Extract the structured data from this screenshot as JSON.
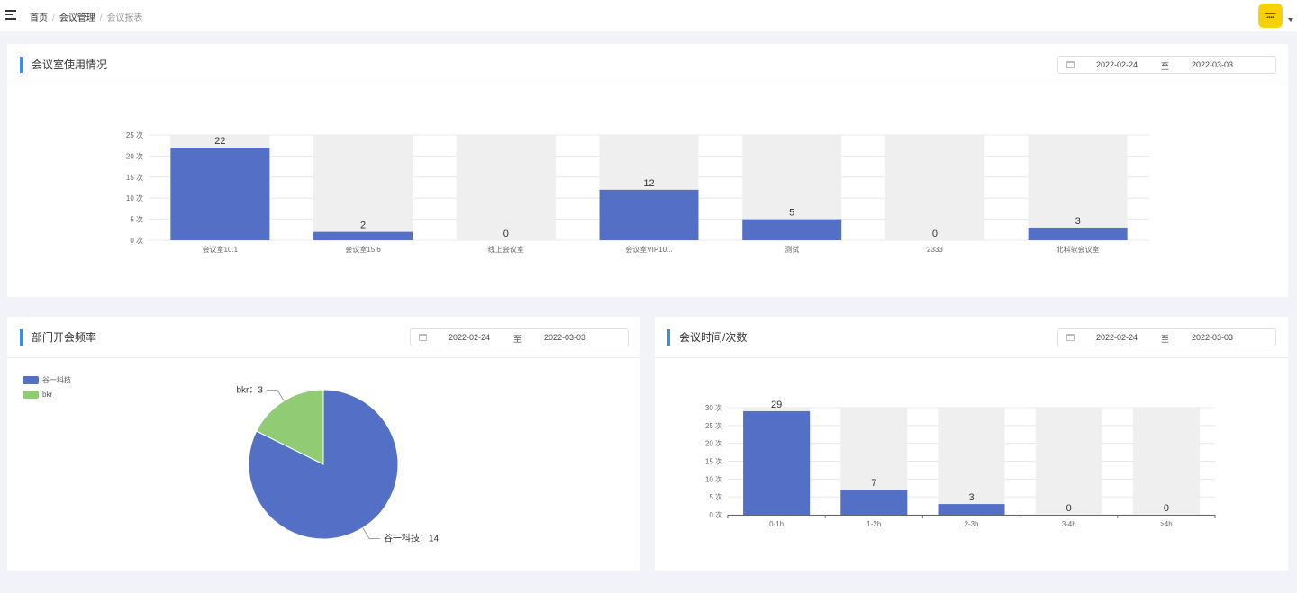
{
  "header": {
    "breadcrumb": [
      "首页",
      "会议管理",
      "会议报表"
    ],
    "separator": "/"
  },
  "colors": {
    "bar": "#5470c6",
    "bar_bg": "#efefef",
    "pie_green": "#91cc75",
    "accent": "#3a8ee6"
  },
  "range_to_label": "至",
  "room_usage": {
    "title": "会议室使用情况",
    "date_start": "2022-02-24",
    "date_end": "2022-03-03"
  },
  "dept_freq": {
    "title": "部门开会频率",
    "date_start": "2022-02-24",
    "date_end": "2022-03-03",
    "legend": [
      "谷一科技",
      "bkr"
    ]
  },
  "meeting_time": {
    "title": "会议时间/次数",
    "date_start": "2022-02-24",
    "date_end": "2022-03-03"
  },
  "chart_data": [
    {
      "type": "bar",
      "categories": [
        "会议室10.1",
        "会议室15.6",
        "线上会议室",
        "会议室VIP10...",
        "测试",
        "2333",
        "北科软会议室"
      ],
      "values": [
        22,
        2,
        0,
        12,
        5,
        0,
        3
      ],
      "ylim": [
        0,
        25
      ],
      "yticks": [
        "0 次",
        "5 次",
        "10 次",
        "15 次",
        "20 次",
        "25 次"
      ],
      "grid": true,
      "background_bars": true
    },
    {
      "type": "pie",
      "labels": [
        "谷一科技",
        "bkr"
      ],
      "values": [
        14,
        3
      ],
      "slice_labels": [
        "谷一科技：14",
        "bkr：3"
      ],
      "legend": "top-left"
    },
    {
      "type": "bar",
      "categories": [
        "0-1h",
        "1-2h",
        "2-3h",
        "3-4h",
        ">4h"
      ],
      "values": [
        29,
        7,
        3,
        0,
        0
      ],
      "ylim": [
        0,
        30
      ],
      "yticks": [
        "0 次",
        "5 次",
        "10 次",
        "15 次",
        "20 次",
        "25 次",
        "30 次"
      ],
      "grid": true,
      "background_bars": true
    }
  ]
}
